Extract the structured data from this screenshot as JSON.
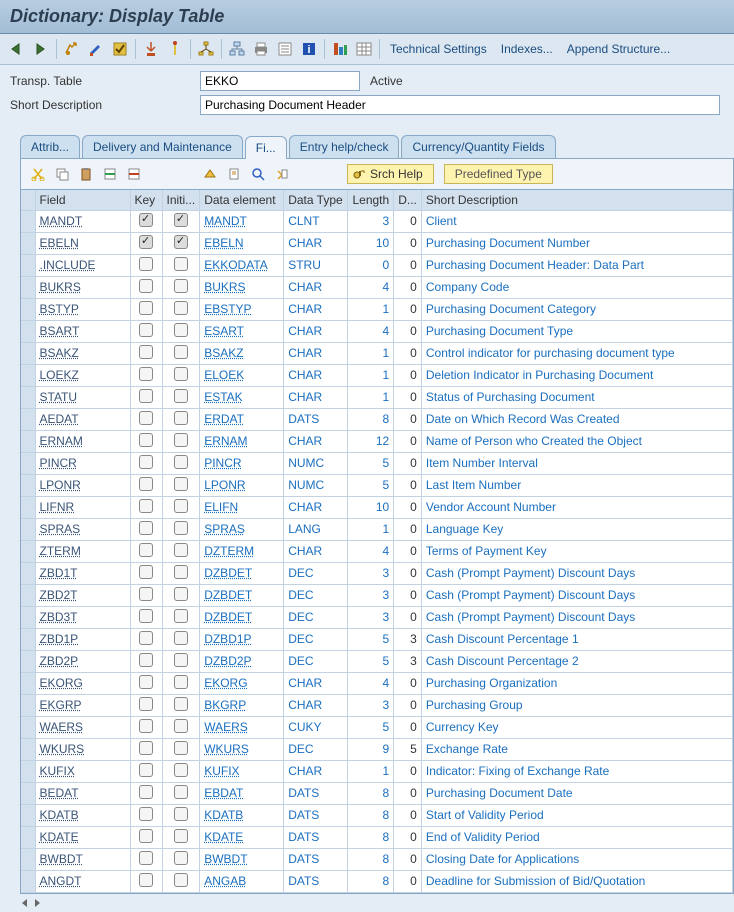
{
  "title": "Dictionary: Display Table",
  "toolbar_links": {
    "tech": "Technical Settings",
    "indexes": "Indexes...",
    "append": "Append Structure..."
  },
  "form": {
    "table_label": "Transp. Table",
    "table_value": "EKKO",
    "table_status": "Active",
    "desc_label": "Short Description",
    "desc_value": "Purchasing Document Header"
  },
  "tabs": {
    "attrib": "Attrib...",
    "deliv": "Delivery and Maintenance",
    "fields": "Fi...",
    "entry": "Entry help/check",
    "curr": "Currency/Quantity Fields"
  },
  "subtoolbar": {
    "srch": "Srch Help",
    "pre": "Predefined Type"
  },
  "cols": {
    "field": "Field",
    "key": "Key",
    "init": "Initi...",
    "elem": "Data element",
    "type": "Data Type",
    "len": "Length",
    "dec": "D...",
    "desc": "Short Description"
  },
  "rows": [
    {
      "field": "MANDT",
      "key": true,
      "init": true,
      "elem": "MANDT",
      "type": "CLNT",
      "len": 3,
      "dec": 0,
      "desc": "Client"
    },
    {
      "field": "EBELN",
      "key": true,
      "init": true,
      "elem": "EBELN",
      "type": "CHAR",
      "len": 10,
      "dec": 0,
      "desc": "Purchasing Document Number"
    },
    {
      "field": ".INCLUDE",
      "key": false,
      "init": false,
      "elem": "EKKODATA",
      "type": "STRU",
      "len": 0,
      "dec": 0,
      "desc": "Purchasing Document Header: Data Part"
    },
    {
      "field": "BUKRS",
      "key": false,
      "init": false,
      "elem": "BUKRS",
      "type": "CHAR",
      "len": 4,
      "dec": 0,
      "desc": "Company Code"
    },
    {
      "field": "BSTYP",
      "key": false,
      "init": false,
      "elem": "EBSTYP",
      "type": "CHAR",
      "len": 1,
      "dec": 0,
      "desc": "Purchasing Document Category"
    },
    {
      "field": "BSART",
      "key": false,
      "init": false,
      "elem": "ESART",
      "type": "CHAR",
      "len": 4,
      "dec": 0,
      "desc": "Purchasing Document Type"
    },
    {
      "field": "BSAKZ",
      "key": false,
      "init": false,
      "elem": "BSAKZ",
      "type": "CHAR",
      "len": 1,
      "dec": 0,
      "desc": "Control indicator for purchasing document type"
    },
    {
      "field": "LOEKZ",
      "key": false,
      "init": false,
      "elem": "ELOEK",
      "type": "CHAR",
      "len": 1,
      "dec": 0,
      "desc": "Deletion Indicator in Purchasing Document"
    },
    {
      "field": "STATU",
      "key": false,
      "init": false,
      "elem": "ESTAK",
      "type": "CHAR",
      "len": 1,
      "dec": 0,
      "desc": "Status of Purchasing Document"
    },
    {
      "field": "AEDAT",
      "key": false,
      "init": false,
      "elem": "ERDAT",
      "type": "DATS",
      "len": 8,
      "dec": 0,
      "desc": "Date on Which Record Was Created"
    },
    {
      "field": "ERNAM",
      "key": false,
      "init": false,
      "elem": "ERNAM",
      "type": "CHAR",
      "len": 12,
      "dec": 0,
      "desc": "Name of Person who Created the Object"
    },
    {
      "field": "PINCR",
      "key": false,
      "init": false,
      "elem": "PINCR",
      "type": "NUMC",
      "len": 5,
      "dec": 0,
      "desc": "Item Number Interval"
    },
    {
      "field": "LPONR",
      "key": false,
      "init": false,
      "elem": "LPONR",
      "type": "NUMC",
      "len": 5,
      "dec": 0,
      "desc": "Last Item Number"
    },
    {
      "field": "LIFNR",
      "key": false,
      "init": false,
      "elem": "ELIFN",
      "type": "CHAR",
      "len": 10,
      "dec": 0,
      "desc": "Vendor Account Number"
    },
    {
      "field": "SPRAS",
      "key": false,
      "init": false,
      "elem": "SPRAS",
      "type": "LANG",
      "len": 1,
      "dec": 0,
      "desc": "Language Key"
    },
    {
      "field": "ZTERM",
      "key": false,
      "init": false,
      "elem": "DZTERM",
      "type": "CHAR",
      "len": 4,
      "dec": 0,
      "desc": "Terms of Payment Key"
    },
    {
      "field": "ZBD1T",
      "key": false,
      "init": false,
      "elem": "DZBDET",
      "type": "DEC",
      "len": 3,
      "dec": 0,
      "desc": "Cash (Prompt Payment) Discount Days"
    },
    {
      "field": "ZBD2T",
      "key": false,
      "init": false,
      "elem": "DZBDET",
      "type": "DEC",
      "len": 3,
      "dec": 0,
      "desc": "Cash (Prompt Payment) Discount Days"
    },
    {
      "field": "ZBD3T",
      "key": false,
      "init": false,
      "elem": "DZBDET",
      "type": "DEC",
      "len": 3,
      "dec": 0,
      "desc": "Cash (Prompt Payment) Discount Days"
    },
    {
      "field": "ZBD1P",
      "key": false,
      "init": false,
      "elem": "DZBD1P",
      "type": "DEC",
      "len": 5,
      "dec": 3,
      "desc": "Cash Discount Percentage 1"
    },
    {
      "field": "ZBD2P",
      "key": false,
      "init": false,
      "elem": "DZBD2P",
      "type": "DEC",
      "len": 5,
      "dec": 3,
      "desc": "Cash Discount Percentage 2"
    },
    {
      "field": "EKORG",
      "key": false,
      "init": false,
      "elem": "EKORG",
      "type": "CHAR",
      "len": 4,
      "dec": 0,
      "desc": "Purchasing Organization"
    },
    {
      "field": "EKGRP",
      "key": false,
      "init": false,
      "elem": "BKGRP",
      "type": "CHAR",
      "len": 3,
      "dec": 0,
      "desc": "Purchasing Group"
    },
    {
      "field": "WAERS",
      "key": false,
      "init": false,
      "elem": "WAERS",
      "type": "CUKY",
      "len": 5,
      "dec": 0,
      "desc": "Currency Key"
    },
    {
      "field": "WKURS",
      "key": false,
      "init": false,
      "elem": "WKURS",
      "type": "DEC",
      "len": 9,
      "dec": 5,
      "desc": "Exchange Rate"
    },
    {
      "field": "KUFIX",
      "key": false,
      "init": false,
      "elem": "KUFIX",
      "type": "CHAR",
      "len": 1,
      "dec": 0,
      "desc": "Indicator: Fixing of Exchange Rate"
    },
    {
      "field": "BEDAT",
      "key": false,
      "init": false,
      "elem": "EBDAT",
      "type": "DATS",
      "len": 8,
      "dec": 0,
      "desc": "Purchasing Document Date"
    },
    {
      "field": "KDATB",
      "key": false,
      "init": false,
      "elem": "KDATB",
      "type": "DATS",
      "len": 8,
      "dec": 0,
      "desc": "Start of Validity Period"
    },
    {
      "field": "KDATE",
      "key": false,
      "init": false,
      "elem": "KDATE",
      "type": "DATS",
      "len": 8,
      "dec": 0,
      "desc": "End of Validity Period"
    },
    {
      "field": "BWBDT",
      "key": false,
      "init": false,
      "elem": "BWBDT",
      "type": "DATS",
      "len": 8,
      "dec": 0,
      "desc": "Closing Date for Applications"
    },
    {
      "field": "ANGDT",
      "key": false,
      "init": false,
      "elem": "ANGAB",
      "type": "DATS",
      "len": 8,
      "dec": 0,
      "desc": "Deadline for Submission of Bid/Quotation"
    }
  ]
}
